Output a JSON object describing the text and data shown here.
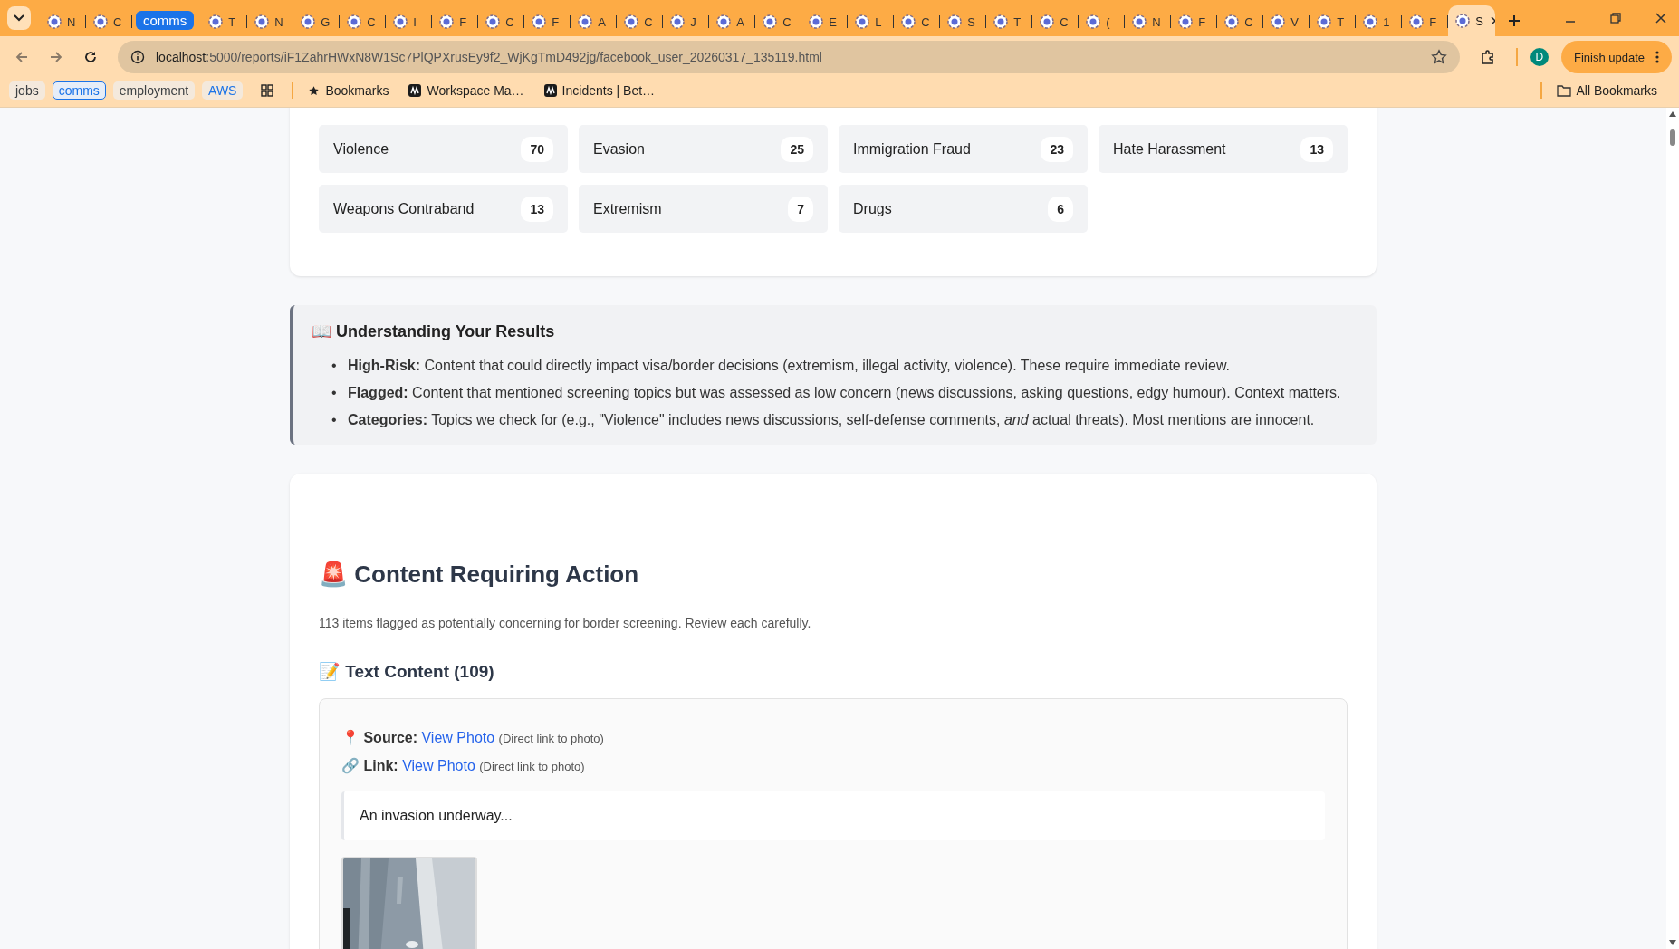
{
  "browser": {
    "tabs": [
      {
        "kind": "tab",
        "label": "N",
        "selected": false
      },
      {
        "kind": "tab",
        "label": "C",
        "selected": false
      },
      {
        "kind": "group",
        "label": "comms"
      },
      {
        "kind": "tab",
        "label": "T",
        "selected": false
      },
      {
        "kind": "tab",
        "label": "N",
        "selected": false
      },
      {
        "kind": "tab",
        "label": "G",
        "selected": false
      },
      {
        "kind": "tab",
        "label": "C",
        "selected": false
      },
      {
        "kind": "tab",
        "label": "I",
        "selected": false
      },
      {
        "kind": "tab",
        "label": "F",
        "selected": false
      },
      {
        "kind": "tab",
        "label": "C",
        "selected": false
      },
      {
        "kind": "tab",
        "label": "F",
        "selected": false
      },
      {
        "kind": "tab",
        "label": "A",
        "selected": false
      },
      {
        "kind": "tab",
        "label": "C",
        "selected": false
      },
      {
        "kind": "tab",
        "label": "J",
        "selected": false
      },
      {
        "kind": "tab",
        "label": "A",
        "selected": false
      },
      {
        "kind": "tab",
        "label": "C",
        "selected": false
      },
      {
        "kind": "tab",
        "label": "E",
        "selected": false
      },
      {
        "kind": "tab",
        "label": "L",
        "selected": false
      },
      {
        "kind": "tab",
        "label": "C",
        "selected": false
      },
      {
        "kind": "tab",
        "label": "S",
        "selected": false
      },
      {
        "kind": "tab",
        "label": "T",
        "selected": false
      },
      {
        "kind": "tab",
        "label": "C",
        "selected": false
      },
      {
        "kind": "tab",
        "label": "(",
        "selected": false
      },
      {
        "kind": "tab",
        "label": "N",
        "selected": false
      },
      {
        "kind": "tab",
        "label": "F",
        "selected": false
      },
      {
        "kind": "tab",
        "label": "C",
        "selected": false
      },
      {
        "kind": "tab",
        "label": "V",
        "selected": false
      },
      {
        "kind": "tab",
        "label": "T",
        "selected": false
      },
      {
        "kind": "tab",
        "label": "1",
        "selected": false
      },
      {
        "kind": "tab",
        "label": "F",
        "selected": false
      },
      {
        "kind": "tab",
        "label": "S",
        "selected": true
      }
    ],
    "address": {
      "host": "localhost",
      "path": ":5000/reports/iF1ZahrHWxN8W1Sc7PlQPXrusEy9f2_WjKgTmD492jg/facebook_user_20260317_135119.html"
    },
    "profile_initial": "D",
    "update_button": "Finish update",
    "bookmarks": [
      {
        "kind": "group",
        "label": "jobs",
        "color": "#3c4043",
        "expanded": false
      },
      {
        "kind": "group",
        "label": "comms",
        "color": "#1a73e8",
        "expanded": true
      },
      {
        "kind": "group",
        "label": "employment",
        "color": "#3c4043",
        "expanded": false
      },
      {
        "kind": "group",
        "label": "AWS",
        "color": "#1a73e8",
        "expanded": false
      },
      {
        "kind": "apps"
      },
      {
        "kind": "folder",
        "label": "Bookmarks"
      },
      {
        "kind": "site",
        "label": "Workspace Ma…"
      },
      {
        "kind": "site",
        "label": "Incidents | Bet…"
      }
    ],
    "all_bookmarks": "All Bookmarks"
  },
  "categories": [
    {
      "name": "Violence",
      "count": "70"
    },
    {
      "name": "Evasion",
      "count": "25"
    },
    {
      "name": "Immigration Fraud",
      "count": "23"
    },
    {
      "name": "Hate Harassment",
      "count": "13"
    },
    {
      "name": "Weapons Contraband",
      "count": "13"
    },
    {
      "name": "Extremism",
      "count": "7"
    },
    {
      "name": "Drugs",
      "count": "6"
    }
  ],
  "info": {
    "title": "📖 Understanding Your Results",
    "marker": "•",
    "items": [
      "**High-Risk:** Content that could directly impact visa/border decisions (extremism, illegal activity, violence). These require immediate review.",
      "**Flagged:** Content that mentioned screening topics but was assessed as low concern (news discussions, asking questions, edgy humour). Context matters.",
      "**Categories:** Topics we check for (e.g., \"Violence\" includes news discussions, self-defense comments, *and* actual threats). Most mentions are innocent."
    ]
  },
  "action": {
    "title": "🚨 Content Requiring Action",
    "summary": "113 items flagged as potentially concerning for border screening. Review each carefully.",
    "section_title": "📝 Text Content (109)",
    "item": {
      "lines": [
        {
          "label": "📍 Source:",
          "link": "View Photo",
          "note": "(Direct link to photo)"
        },
        {
          "label": "🔗 Link:",
          "link": "View Photo",
          "note": "(Direct link to photo)"
        }
      ],
      "quote": "An invasion underway..."
    }
  }
}
